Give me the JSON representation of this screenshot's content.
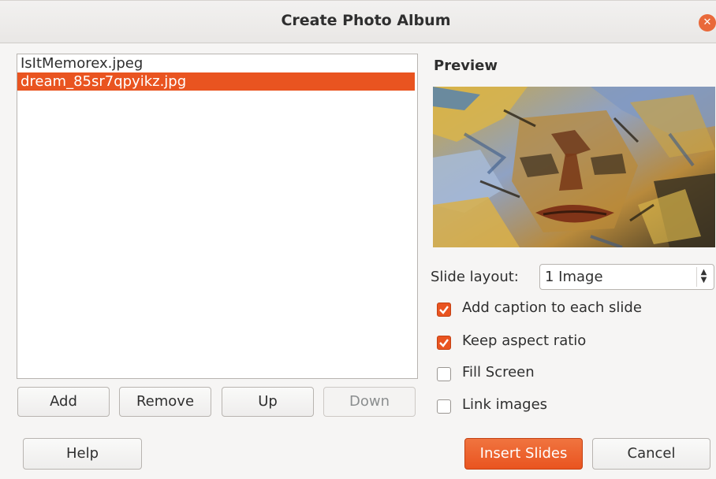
{
  "window": {
    "title": "Create Photo Album"
  },
  "files": [
    {
      "name": "IsItMemorex.jpeg",
      "selected": false
    },
    {
      "name": "dream_85sr7qpyikz.jpg",
      "selected": true
    }
  ],
  "list_buttons": {
    "add": "Add",
    "remove": "Remove",
    "up": "Up",
    "down": "Down"
  },
  "preview": {
    "label": "Preview"
  },
  "slide_layout": {
    "label": "Slide layout:",
    "value": "1 Image"
  },
  "options": [
    {
      "label": "Add caption to each slide",
      "checked": true
    },
    {
      "label": "Keep aspect ratio",
      "checked": true
    },
    {
      "label": "Fill Screen",
      "checked": false
    },
    {
      "label": "Link images",
      "checked": false
    }
  ],
  "footer": {
    "help": "Help",
    "insert": "Insert Slides",
    "cancel": "Cancel"
  },
  "colors": {
    "accent": "#e95420",
    "dialog_bg": "#f6f5f4"
  }
}
